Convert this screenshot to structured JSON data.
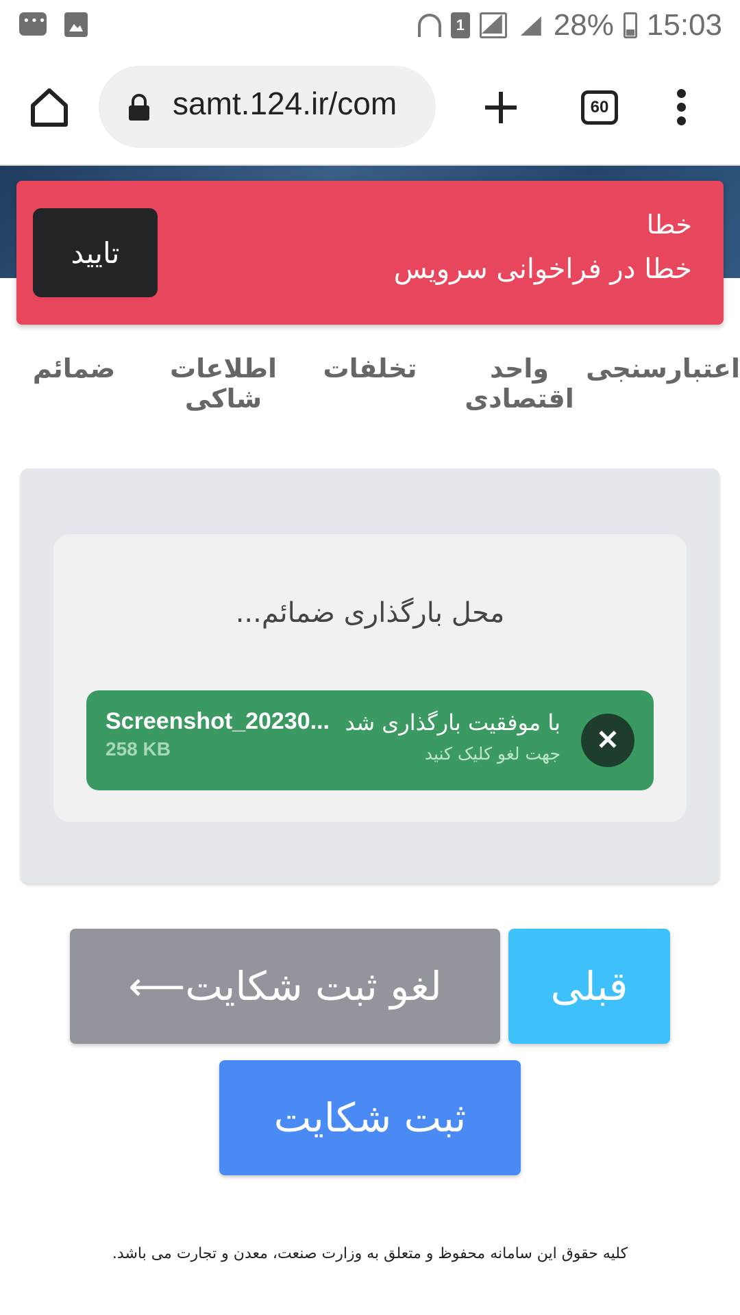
{
  "status_bar": {
    "battery": "28%",
    "time": "15:03",
    "sim_slot": "1"
  },
  "browser": {
    "url": "samt.124.ir/com",
    "tab_count": "60"
  },
  "steps": [
    {
      "label": "ضمائم",
      "color": "#7a7a7a"
    },
    {
      "label": "اطلاعات شاکی",
      "color": "#3a9a3a"
    },
    {
      "label": "تخلفات",
      "color": "#3a9a3a"
    },
    {
      "label": "واحد اقتصادی",
      "color": "#3a9a3a"
    },
    {
      "label": "اعتبارسنجی",
      "color": "#3a9a3a"
    }
  ],
  "toast": {
    "title": "خطا",
    "message": "خطا در فراخوانی سرویس",
    "confirm_label": "تایید",
    "color": "#e8465c"
  },
  "upload": {
    "dropzone_label": "محل بارگذاری ضمائم...",
    "file": {
      "name": "Screenshot_20230...",
      "size": "258 KB",
      "status": "با موفقیت بارگذاری شد",
      "hint": "جهت لغو کلیک کنید"
    }
  },
  "actions": {
    "cancel_label": "لغو ثبت شکایت⟵",
    "prev_label": "قبلی",
    "submit_label": "ثبت شکایت"
  },
  "footer": {
    "text": "کلیه حقوق این سامانه محفوظ و متعلق به وزارت صنعت، معدن و تجارت می باشد."
  }
}
